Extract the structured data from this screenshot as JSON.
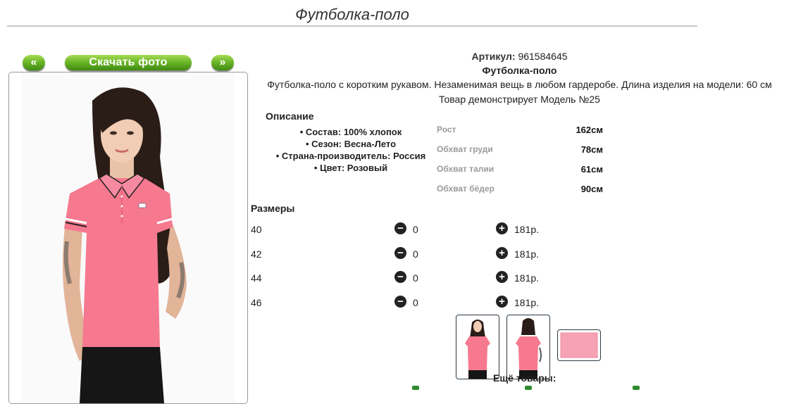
{
  "page": {
    "title": "Футболка-поло"
  },
  "photo_nav": {
    "prev_label": "«",
    "download_label": "Скачать фото",
    "next_label": "»"
  },
  "product": {
    "sku_label": "Артикул:",
    "sku_value": "961584645",
    "name": "Футболка-поло",
    "description": "Футболка-поло с коротким рукавом. Незаменимая вещь в любом гардеробе. Длина изделия на модели: 60 см",
    "model_note": "Товар демонстрирует Модель №25"
  },
  "details": {
    "heading": "Описание",
    "features": [
      "Состав: 100% хлопок",
      "Сезон: Весна-Лето",
      "Страна-производитель: Россия",
      "Цвет: Розовый"
    ]
  },
  "measurements": [
    {
      "label": "Рост",
      "value": "162см"
    },
    {
      "label": "Обхват груди",
      "value": "78см"
    },
    {
      "label": "Обхват талии",
      "value": "61см"
    },
    {
      "label": "Обхват бёдер",
      "value": "90см"
    }
  ],
  "sizes": {
    "heading": "Размеры",
    "items": [
      {
        "size": "40",
        "qty": "0",
        "price": "181р."
      },
      {
        "size": "42",
        "qty": "0",
        "price": "181р."
      },
      {
        "size": "44",
        "qty": "0",
        "price": "181р."
      },
      {
        "size": "46",
        "qty": "0",
        "price": "181р."
      }
    ]
  },
  "more_products": {
    "heading": "Ещё товары:"
  },
  "colors": {
    "accent_green": "#6cb72a",
    "shirt_pink": "#f6798f"
  },
  "icons": {
    "minus": "minus-circle-icon",
    "plus": "plus-circle-icon"
  }
}
